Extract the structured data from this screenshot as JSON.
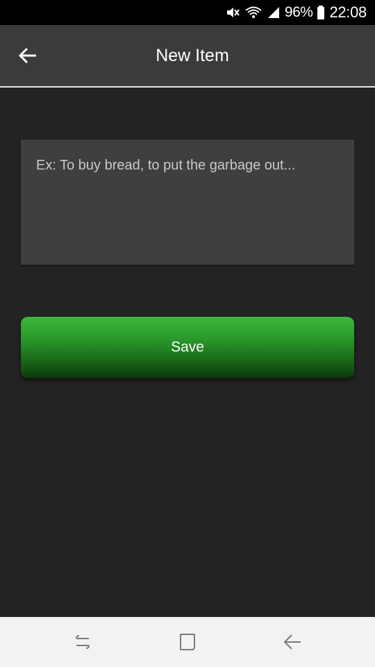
{
  "status_bar": {
    "icons": [
      "mute-icon",
      "wifi-icon",
      "signal-icon",
      "battery-icon"
    ],
    "battery_percent": "96%",
    "time": "22:08"
  },
  "app_bar": {
    "back_icon": "arrow-back-icon",
    "title": "New Item"
  },
  "form": {
    "item_input": {
      "placeholder": "Ex: To buy bread, to put the garbage out...",
      "value": ""
    },
    "save_label": "Save"
  },
  "nav_bar": {
    "buttons": [
      "recent-apps-icon",
      "home-icon",
      "back-icon"
    ]
  },
  "colors": {
    "background": "#232323",
    "app_bar": "#3b3b3b",
    "input_bg": "#3f3f3f",
    "accent_green": "#2a9a2a",
    "nav_bar": "#f2f2f2"
  }
}
